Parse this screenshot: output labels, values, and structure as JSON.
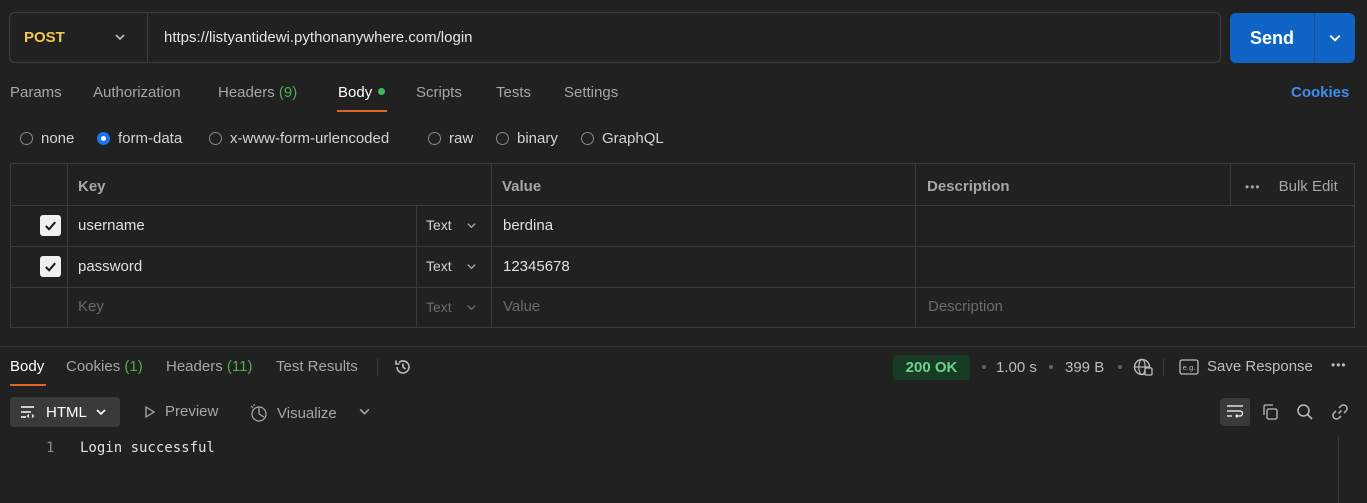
{
  "request": {
    "method": "POST",
    "url": "https://listyantidewi.pythonanywhere.com/login",
    "send_label": "Send"
  },
  "request_tabs": {
    "params": "Params",
    "authorization": "Authorization",
    "headers": "Headers",
    "headers_count": "(9)",
    "body": "Body",
    "scripts": "Scripts",
    "tests": "Tests",
    "settings": "Settings",
    "cookies": "Cookies"
  },
  "body_modes": {
    "none": "none",
    "form_data": "form-data",
    "urlencoded": "x-www-form-urlencoded",
    "raw": "raw",
    "binary": "binary",
    "graphql": "GraphQL",
    "selected": "form-data"
  },
  "table": {
    "headers": {
      "key": "Key",
      "value": "Value",
      "description": "Description",
      "bulk_edit": "Bulk Edit"
    },
    "rows": [
      {
        "checked": true,
        "key": "username",
        "type": "Text",
        "value": "berdina",
        "description": ""
      },
      {
        "checked": true,
        "key": "password",
        "type": "Text",
        "value": "12345678",
        "description": ""
      }
    ],
    "placeholders": {
      "key": "Key",
      "type": "Text",
      "value": "Value",
      "description": "Description"
    }
  },
  "response": {
    "tabs": {
      "body": "Body",
      "cookies": "Cookies",
      "cookies_count": "(1)",
      "headers": "Headers",
      "headers_count": "(11)",
      "test_results": "Test Results"
    },
    "status": "200 OK",
    "time": "1.00 s",
    "size": "399 B",
    "save_label": "Save Response",
    "format": "HTML",
    "preview": "Preview",
    "visualize": "Visualize",
    "lines": [
      {
        "number": "1",
        "text": "Login successful"
      }
    ]
  },
  "colors": {
    "background": "#212121",
    "send_button": "#0f64c6",
    "method": "#f2c94c",
    "status_ok": "#6cd38c",
    "accent_underline": "#e0642a",
    "link": "#3e8ef0"
  }
}
